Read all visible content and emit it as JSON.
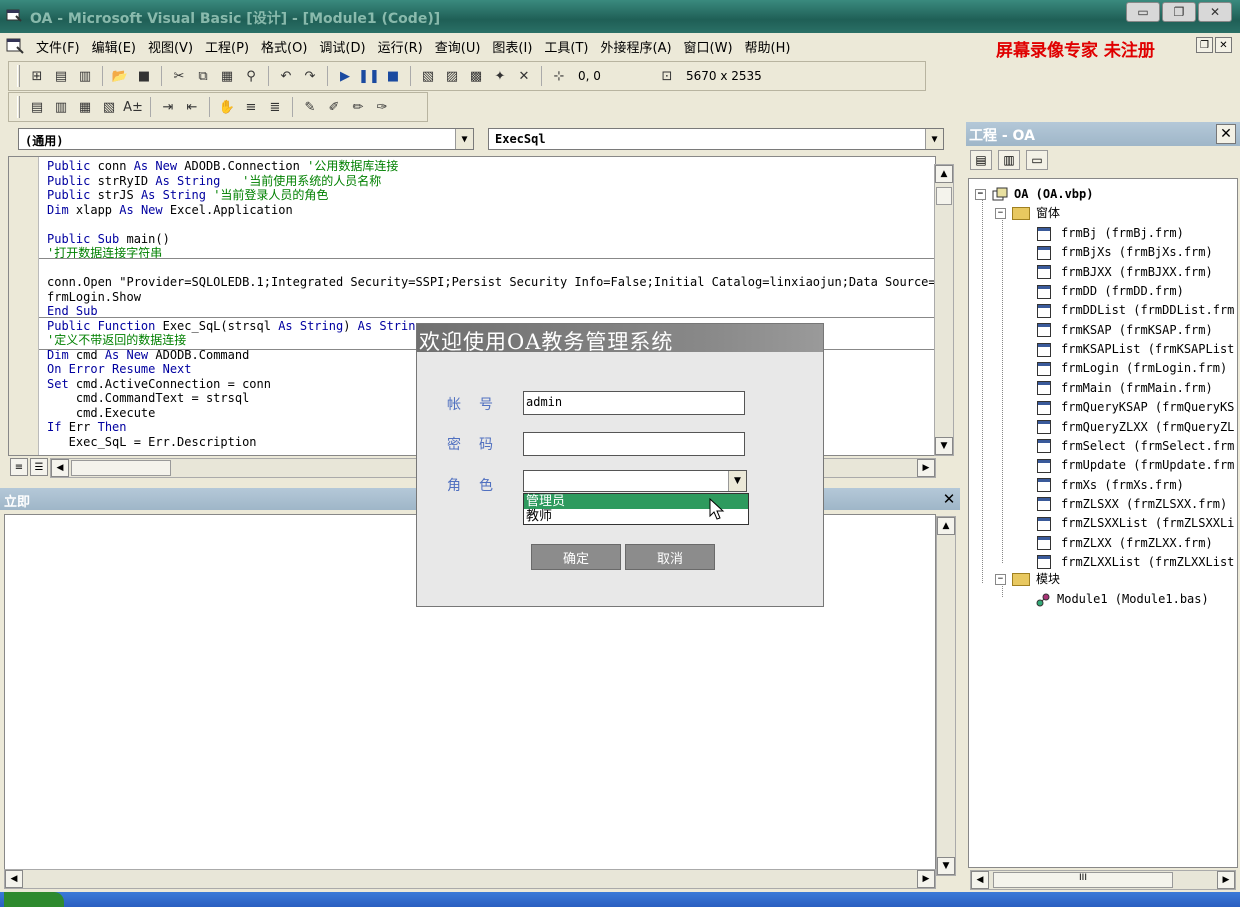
{
  "window": {
    "title": "OA - Microsoft Visual Basic [设计] - [Module1 (Code)]"
  },
  "menubar": {
    "items": [
      "文件(F)",
      "编辑(E)",
      "视图(V)",
      "工程(P)",
      "格式(O)",
      "调试(D)",
      "运行(R)",
      "查询(U)",
      "图表(I)",
      "工具(T)",
      "外接程序(A)",
      "窗口(W)",
      "帮助(H)"
    ],
    "recorder_label": "屏幕录像专家  未注册"
  },
  "toolbar": {
    "position": "0, 0",
    "size": "5670 x 2535"
  },
  "code_window": {
    "object_combo": "(通用)",
    "proc_combo": "ExecSql",
    "lines": [
      [
        {
          "t": "Public ",
          "c": "kw"
        },
        {
          "t": "conn ",
          "c": ""
        },
        {
          "t": "As New ",
          "c": "kw"
        },
        {
          "t": "ADODB.Connection ",
          "c": ""
        },
        {
          "t": "'公用数据库连接",
          "c": "cm"
        }
      ],
      [
        {
          "t": "Public ",
          "c": "kw"
        },
        {
          "t": "strRyID ",
          "c": ""
        },
        {
          "t": "As String",
          "c": "kw"
        },
        {
          "t": "   '当前使用系统的人员名称",
          "c": "cm"
        }
      ],
      [
        {
          "t": "Public ",
          "c": "kw"
        },
        {
          "t": "strJS ",
          "c": ""
        },
        {
          "t": "As String ",
          "c": "kw"
        },
        {
          "t": "'当前登录人员的角色",
          "c": "cm"
        }
      ],
      [
        {
          "t": "Dim ",
          "c": "kw"
        },
        {
          "t": "xlapp ",
          "c": ""
        },
        {
          "t": "As New ",
          "c": "kw"
        },
        {
          "t": "Excel.Application",
          "c": ""
        }
      ],
      [
        {
          "t": "",
          "c": ""
        }
      ],
      [
        {
          "t": "Public Sub ",
          "c": "kw"
        },
        {
          "t": "main()",
          "c": ""
        }
      ],
      [
        {
          "t": "'打开数据连接字符串",
          "c": "cm"
        }
      ],
      [
        {
          "t": "",
          "c": ""
        }
      ],
      [
        {
          "t": "conn.Open \"Provider=SQLOLEDB.1;Integrated Security=SSPI;Persist Security Info=False;Initial Catalog=linxiaojun;Data Source=",
          "c": ""
        }
      ],
      [
        {
          "t": "frmLogin.Show",
          "c": ""
        }
      ],
      [
        {
          "t": "End Sub",
          "c": "kw"
        }
      ],
      [
        {
          "t": "Public Function ",
          "c": "kw"
        },
        {
          "t": "Exec_SqL(strsql ",
          "c": ""
        },
        {
          "t": "As String",
          "c": "kw"
        },
        {
          "t": ") ",
          "c": ""
        },
        {
          "t": "As Strin",
          "c": "kw"
        }
      ],
      [
        {
          "t": "'定义不带返回的数据连接",
          "c": "cm"
        }
      ],
      [
        {
          "t": "Dim ",
          "c": "kw"
        },
        {
          "t": "cmd ",
          "c": ""
        },
        {
          "t": "As New ",
          "c": "kw"
        },
        {
          "t": "ADODB.Command",
          "c": ""
        }
      ],
      [
        {
          "t": "On Error Resume Next",
          "c": "kw"
        }
      ],
      [
        {
          "t": "Set ",
          "c": "kw"
        },
        {
          "t": "cmd.ActiveConnection = conn",
          "c": ""
        }
      ],
      [
        {
          "t": "    cmd.CommandText = strsql",
          "c": ""
        }
      ],
      [
        {
          "t": "    cmd.Execute",
          "c": ""
        }
      ],
      [
        {
          "t": "If ",
          "c": "kw"
        },
        {
          "t": "Err ",
          "c": ""
        },
        {
          "t": "Then",
          "c": "kw"
        }
      ],
      [
        {
          "t": "   Exec_SqL = Err.Description",
          "c": ""
        }
      ]
    ]
  },
  "immediate_window": {
    "title": "立即"
  },
  "project_explorer": {
    "title": "工程 - OA",
    "project": "OA (OA.vbp)",
    "forms_folder": "窗体",
    "forms": [
      "frmBj (frmBj.frm)",
      "frmBjXs (frmBjXs.frm)",
      "frmBJXX (frmBJXX.frm)",
      "frmDD (frmDD.frm)",
      "frmDDList (frmDDList.frm",
      "frmKSAP (frmKSAP.frm)",
      "frmKSAPList (frmKSAPList",
      "frmLogin (frmLogin.frm)",
      "frmMain (frmMain.frm)",
      "frmQueryKSAP (frmQueryKS",
      "frmQueryZLXX (frmQueryZL",
      "frmSelect (frmSelect.frm",
      "frmUpdate (frmUpdate.frm",
      "frmXs (frmXs.frm)",
      "frmZLSXX (frmZLSXX.frm)",
      "frmZLSXXList (frmZLSXXLi",
      "frmZLXX (frmZLXX.frm)",
      "frmZLXXList (frmZLXXList"
    ],
    "modules_folder": "模块",
    "modules": [
      "Module1 (Module1.bas)"
    ],
    "hscroll_label": "III"
  },
  "login_dialog": {
    "title": "欢迎使用OA教务管理系统",
    "account_label": "帐号",
    "account_value": "admin",
    "password_label": "密码",
    "password_value": "",
    "role_label": "角色",
    "role_value": "",
    "role_options": [
      "管理员",
      "教师"
    ],
    "ok_label": "确定",
    "cancel_label": "取消"
  },
  "colors": {
    "keyword": "#0000a0",
    "comment": "#008000",
    "recorder_red": "#e00000",
    "dropdown_highlight": "#2e9a5e"
  }
}
